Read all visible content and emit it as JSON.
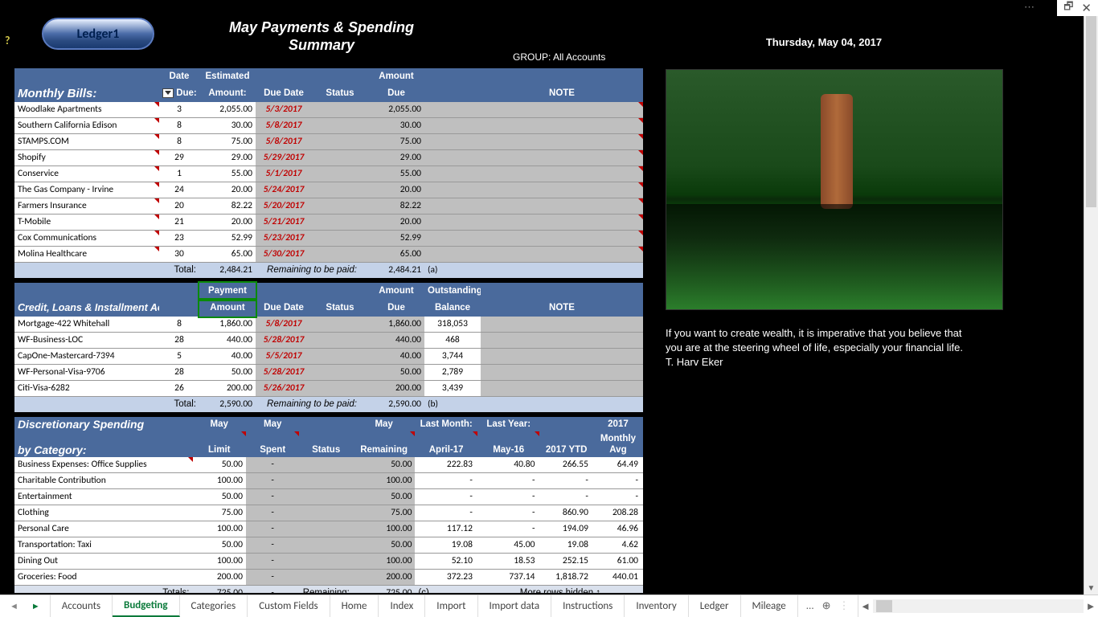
{
  "window": {
    "dots": "⋯",
    "restore": "🗗",
    "close": "✕"
  },
  "ledger": "Ledger1",
  "title_l1": "May Payments & Spending",
  "title_l2": "Summary",
  "group": "GROUP:  All Accounts",
  "date": "Thursday, May 04, 2017",
  "help": "?",
  "bills": {
    "section": "Monthly Bills:",
    "h_datedue_l1": "Date",
    "h_datedue_l2": "Due:",
    "h_est_l1": "Estimated",
    "h_est_l2": "Amount:",
    "h_duedate": "Due Date",
    "h_status": "Status",
    "h_amt_l1": "Amount",
    "h_amt_l2": "Due",
    "h_note": "NOTE",
    "rows": [
      {
        "name": "Woodlake Apartments",
        "dd": "3",
        "est": "2,055.00",
        "due": "5/3/2017",
        "amt": "2,055.00"
      },
      {
        "name": "Southern California Edison",
        "dd": "8",
        "est": "30.00",
        "due": "5/8/2017",
        "amt": "30.00"
      },
      {
        "name": "STAMPS.COM",
        "dd": "8",
        "est": "75.00",
        "due": "5/8/2017",
        "amt": "75.00"
      },
      {
        "name": "Shopify",
        "dd": "29",
        "est": "29.00",
        "due": "5/29/2017",
        "amt": "29.00"
      },
      {
        "name": "Conservice",
        "dd": "1",
        "est": "55.00",
        "due": "5/1/2017",
        "amt": "55.00"
      },
      {
        "name": "The Gas Company - Irvine",
        "dd": "24",
        "est": "20.00",
        "due": "5/24/2017",
        "amt": "20.00"
      },
      {
        "name": "Farmers Insurance",
        "dd": "20",
        "est": "82.22",
        "due": "5/20/2017",
        "amt": "82.22"
      },
      {
        "name": "T-Mobile",
        "dd": "21",
        "est": "20.00",
        "due": "5/21/2017",
        "amt": "20.00"
      },
      {
        "name": "Cox Communications",
        "dd": "23",
        "est": "52.99",
        "due": "5/23/2017",
        "amt": "52.99"
      },
      {
        "name": "Molina Healthcare",
        "dd": "30",
        "est": "65.00",
        "due": "5/30/2017",
        "amt": "65.00"
      }
    ],
    "total_lbl": "Total:",
    "total": "2,484.21",
    "remaining_lbl": "Remaining to be paid:",
    "remaining": "2,484.21",
    "tag": "(a)"
  },
  "credit": {
    "section": "Credit, Loans & Installment Accounts:",
    "h_pay_l1": "Payment",
    "h_pay_l2": "Amount",
    "h_duedate": "Due Date",
    "h_status": "Status",
    "h_amt_l1": "Amount",
    "h_amt_l2": "Due",
    "h_out_l1": "Outstanding",
    "h_out_l2": "Balance",
    "h_note": "NOTE",
    "rows": [
      {
        "name": "Mortgage-422 Whitehall",
        "dd": "8",
        "pay": "1,860.00",
        "due": "5/8/2017",
        "amt": "1,860.00",
        "bal": "318,053"
      },
      {
        "name": "WF-Business-LOC",
        "dd": "28",
        "pay": "440.00",
        "due": "5/28/2017",
        "amt": "440.00",
        "bal": "468"
      },
      {
        "name": "CapOne-Mastercard-7394",
        "dd": "5",
        "pay": "40.00",
        "due": "5/5/2017",
        "amt": "40.00",
        "bal": "3,744"
      },
      {
        "name": "WF-Personal-Visa-9706",
        "dd": "28",
        "pay": "50.00",
        "due": "5/28/2017",
        "amt": "50.00",
        "bal": "2,789"
      },
      {
        "name": "Citi-Visa-6282",
        "dd": "26",
        "pay": "200.00",
        "due": "5/26/2017",
        "amt": "200.00",
        "bal": "3,439"
      }
    ],
    "total_lbl": "Total:",
    "total": "2,590.00",
    "remaining_lbl": "Remaining to be paid:",
    "remaining": "2,590.00",
    "tag": "(b)"
  },
  "disc": {
    "section_l1": "Discretionary Spending",
    "section_l2": "by Category:",
    "h_limit_l1": "May",
    "h_limit_l2": "Limit",
    "h_spent_l1": "May",
    "h_spent_l2": "Spent",
    "h_status": "Status",
    "h_rem_l1": "May",
    "h_rem_l2": "Remaining",
    "h_lastm_l1": "Last Month:",
    "h_lastm_l2": "April-17",
    "h_lasty_l1": "Last Year:",
    "h_lasty_l2": "May-16",
    "h_ytd": "2017 YTD",
    "h_avg_l1": "2017",
    "h_avg_l2": "Monthly",
    "h_avg_l3": "Avg",
    "rows": [
      {
        "name": "Business Expenses: Office Supplies",
        "limit": "50.00",
        "spent": "-",
        "rem": "50.00",
        "lm": "222.83",
        "ly": "40.80",
        "ytd": "266.55",
        "avg": "64.49"
      },
      {
        "name": "Charitable Contribution",
        "limit": "100.00",
        "spent": "-",
        "rem": "100.00",
        "lm": "-",
        "ly": "-",
        "ytd": "-",
        "avg": "-"
      },
      {
        "name": "Entertainment",
        "limit": "50.00",
        "spent": "-",
        "rem": "50.00",
        "lm": "-",
        "ly": "-",
        "ytd": "-",
        "avg": "-"
      },
      {
        "name": "Clothing",
        "limit": "75.00",
        "spent": "-",
        "rem": "75.00",
        "lm": "-",
        "ly": "-",
        "ytd": "860.90",
        "avg": "208.28"
      },
      {
        "name": "Personal Care",
        "limit": "100.00",
        "spent": "-",
        "rem": "100.00",
        "lm": "117.12",
        "ly": "-",
        "ytd": "194.09",
        "avg": "46.96"
      },
      {
        "name": "Transportation: Taxi",
        "limit": "50.00",
        "spent": "-",
        "rem": "50.00",
        "lm": "19.08",
        "ly": "45.00",
        "ytd": "19.08",
        "avg": "4.62"
      },
      {
        "name": "Dining Out",
        "limit": "100.00",
        "spent": "-",
        "rem": "100.00",
        "lm": "52.10",
        "ly": "18.53",
        "ytd": "252.15",
        "avg": "61.00"
      },
      {
        "name": "Groceries: Food",
        "limit": "200.00",
        "spent": "-",
        "rem": "200.00",
        "lm": "372.23",
        "ly": "737.14",
        "ytd": "1,818.72",
        "avg": "440.01"
      }
    ],
    "totals_lbl": "Totals:",
    "totals": "725.00",
    "rem_lbl": "Remaining:",
    "rem_total": "725.00",
    "tag": "(c)",
    "more": "More rows hidden ↑"
  },
  "quote": "If you want to create wealth, it is imperative that you believe that you are at the steering wheel of life, especially your financial life.  T. Harv Eker",
  "tabs": {
    "items": [
      "Accounts",
      "Budgeting",
      "Categories",
      "Custom Fields",
      "Home",
      "Index",
      "Import",
      "Import data",
      "Instructions",
      "Inventory",
      "Ledger",
      "Mileage"
    ],
    "more": "...",
    "plus": "⊕"
  }
}
